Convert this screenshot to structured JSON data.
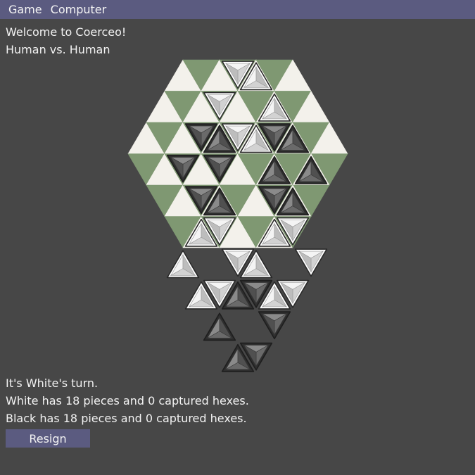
{
  "menu": {
    "game": "Game",
    "computer": "Computer"
  },
  "header": {
    "welcome": "Welcome to Coerceo!",
    "mode": "Human vs. Human"
  },
  "status": {
    "turn": "It's White's turn.",
    "white": "White has 18 pieces and 0 captured hexes.",
    "black": "Black has 18 pieces and 0 captured hexes."
  },
  "buttons": {
    "resign": "Resign"
  },
  "colors": {
    "background": "#474747",
    "menubar": "#5b5b80",
    "tile_light": "#f3f1eb",
    "tile_green": "#7f9872",
    "piece_white": "#e3e3e3",
    "piece_black": "#6d6d6d"
  },
  "board": {
    "hexes": [
      [
        0,
        -2
      ],
      [
        1,
        -2
      ],
      [
        2,
        -2
      ],
      [
        -1,
        -1
      ],
      [
        0,
        -1
      ],
      [
        1,
        -1
      ],
      [
        2,
        -1
      ],
      [
        -2,
        0
      ],
      [
        -1,
        0
      ],
      [
        0,
        0
      ],
      [
        1,
        0
      ],
      [
        2,
        0
      ],
      [
        -2,
        1
      ],
      [
        -1,
        1
      ],
      [
        0,
        1
      ],
      [
        1,
        1
      ],
      [
        -2,
        2
      ],
      [
        -1,
        2
      ],
      [
        0,
        2
      ]
    ],
    "pieces": [
      {
        "color": "white",
        "x": 0,
        "y": 0
      },
      {
        "color": "white",
        "x": 1,
        "y": 0
      },
      {
        "color": "white",
        "x": -1,
        "y": 1
      },
      {
        "color": "white",
        "x": 2,
        "y": 1
      },
      {
        "color": "white",
        "x": 0,
        "y": 2
      },
      {
        "color": "white",
        "x": 1,
        "y": 2
      },
      {
        "color": "black",
        "x": -2,
        "y": 2
      },
      {
        "color": "black",
        "x": -1,
        "y": 2
      },
      {
        "color": "black",
        "x": 2,
        "y": 2
      },
      {
        "color": "black",
        "x": 3,
        "y": 2
      },
      {
        "color": "black",
        "x": -3,
        "y": 3
      },
      {
        "color": "black",
        "x": -1,
        "y": 3
      },
      {
        "color": "black",
        "x": 2,
        "y": 3
      },
      {
        "color": "black",
        "x": 4,
        "y": 3
      },
      {
        "color": "black",
        "x": -2,
        "y": 4
      },
      {
        "color": "black",
        "x": -1,
        "y": 4
      },
      {
        "color": "black",
        "x": 2,
        "y": 4
      },
      {
        "color": "black",
        "x": 3,
        "y": 4
      },
      {
        "color": "white",
        "x": -2,
        "y": 5
      },
      {
        "color": "white",
        "x": -1,
        "y": 5
      },
      {
        "color": "white",
        "x": 2,
        "y": 5
      },
      {
        "color": "white",
        "x": 3,
        "y": 5
      },
      {
        "color": "white",
        "x": -3,
        "y": 6
      },
      {
        "color": "white",
        "x": 0,
        "y": 6
      },
      {
        "color": "white",
        "x": 1,
        "y": 6
      },
      {
        "color": "white",
        "x": 4,
        "y": 6
      },
      {
        "color": "white",
        "x": -2,
        "y": 7
      },
      {
        "color": "white",
        "x": -1,
        "y": 7
      },
      {
        "color": "white",
        "x": 2,
        "y": 7
      },
      {
        "color": "white",
        "x": 3,
        "y": 7
      },
      {
        "color": "black",
        "x": 0,
        "y": 7
      },
      {
        "color": "black",
        "x": 1,
        "y": 7
      },
      {
        "color": "black",
        "x": -1,
        "y": 8
      },
      {
        "color": "black",
        "x": 2,
        "y": 8
      },
      {
        "color": "black",
        "x": 0,
        "y": 9
      },
      {
        "color": "black",
        "x": 1,
        "y": 9
      }
    ]
  }
}
